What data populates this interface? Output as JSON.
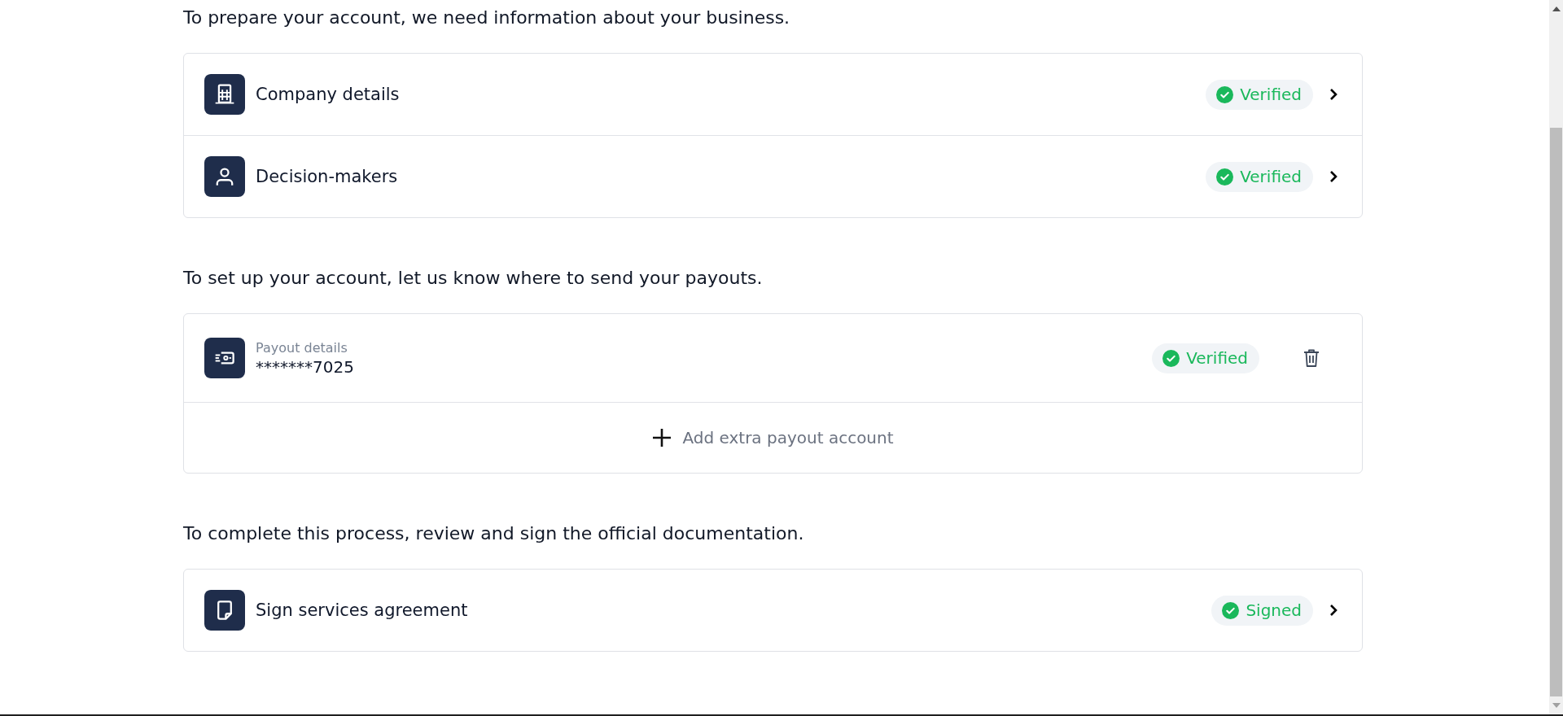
{
  "sections": [
    {
      "heading": "To prepare your account, we need information about your business.",
      "rows": [
        {
          "kind": "link",
          "title": "Company details",
          "badge": "Verified"
        },
        {
          "kind": "link",
          "title": "Decision-makers",
          "badge": "Verified"
        }
      ]
    },
    {
      "heading": "To set up your account, let us know where to send your payouts.",
      "rows": [
        {
          "kind": "payout",
          "caption": "Payout details",
          "value": "*******7025",
          "badge": "Verified"
        },
        {
          "kind": "add",
          "label": "Add extra payout account"
        }
      ]
    },
    {
      "heading": "To complete this process, review and sign the official documentation.",
      "rows": [
        {
          "kind": "link",
          "title": "Sign services agreement",
          "badge": "Signed"
        }
      ]
    }
  ]
}
